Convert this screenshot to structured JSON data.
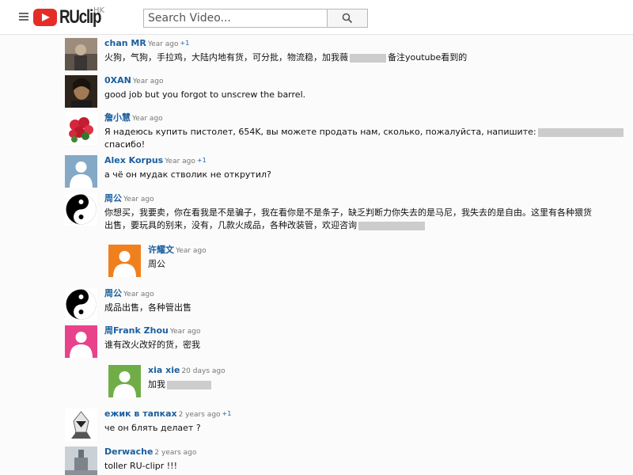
{
  "header": {
    "logo_text": "RUclip",
    "region": "HK",
    "search_placeholder": "Search Video..."
  },
  "comments": [
    {
      "author": "chan MR",
      "time": "Year ago",
      "plus": "+1",
      "text": "火狗，气狗，手拉鸡，大陆内地有货，可分批，物流稳，加我薇",
      "text2": "备注youtube看到的"
    },
    {
      "author": "0XAN",
      "time": "Year ago",
      "text": "good job but you forgot to unscrew the barrel."
    },
    {
      "author": "詹小慧",
      "time": "Year ago",
      "text": "Я надеюсь купить пистолет, 654K, вы можете продать нам, сколько, пожалуйста, напишите:",
      "text_line2": "спасибо!"
    },
    {
      "author": "Alex Korpus",
      "time": "Year ago",
      "plus": "+1",
      "text": "а чё он мудак стволик не открутил?"
    },
    {
      "author": "周公",
      "time": "Year ago",
      "text": "你想买，我要卖，你在看我是不是骗子，我在看你是不是条子，缺乏判断力你失去的是马尼，我失去的是自由。这里有各种猥货",
      "text_line2": "出售，要玩具的别来，没有，几款火成品，各种改装管，欢迎咨询"
    },
    {
      "author": "许耀文",
      "time": "Year ago",
      "text": "周公"
    },
    {
      "author": "周公",
      "time": "Year ago",
      "text": "成品出售，各种管出售"
    },
    {
      "author": "周Frank Zhou",
      "time": "Year ago",
      "text": "谁有改火改好的货，密我"
    },
    {
      "author": "xia xie",
      "time": "20 days ago",
      "text": "加我"
    },
    {
      "author": "ежик в тапках",
      "time": "2 years ago",
      "plus": "+1",
      "text": "че он блять делает ?"
    },
    {
      "author": "Derwache",
      "time": "2 years ago",
      "text": "toller RU-clipr !!!"
    }
  ],
  "colors": {
    "link": "#1a5fa0",
    "logo_red": "#e52d27",
    "avatar_gray": "#83a9c6",
    "avatar_orange": "#f0801e",
    "avatar_pink": "#e8428a",
    "avatar_green": "#70ad47"
  }
}
